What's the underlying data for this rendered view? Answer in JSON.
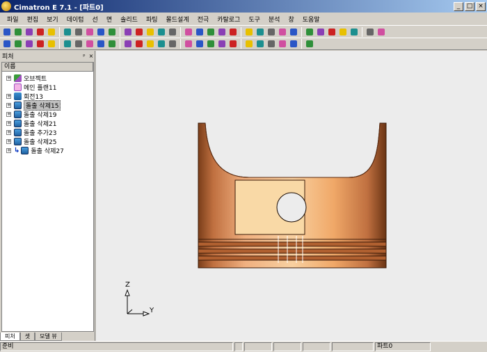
{
  "window": {
    "title": "Cimatron E 7.1 - [파트0]",
    "controls": [
      "_",
      "□",
      "×"
    ]
  },
  "menu": [
    "파일",
    "편집",
    "보기",
    "데이텀",
    "선",
    "면",
    "솔리드",
    "파팅",
    "몰드설계",
    "전극",
    "카탈로그",
    "도구",
    "분석",
    "창",
    "도움말"
  ],
  "toolbar1_icons": [
    "new-icon",
    "open-icon",
    "save-icon",
    "print-icon",
    "undo-icon",
    "redo-icon",
    "link-icon",
    "filter-icon",
    "zoom-fit-icon",
    "zoom-window-icon",
    "zoom-icon",
    "pan-icon",
    "rotate-icon",
    "view-iso-icon",
    "view-front-icon",
    "view-top-icon",
    "view-right-icon",
    "view-left-icon",
    "view-back-icon",
    "view-bottom-icon",
    "render-mode-icon",
    "shade-icon",
    "wireframe-icon",
    "light-icon",
    "bulb-icon",
    "color-icon",
    "arrow-left-icon",
    "arrow-right-icon",
    "grid-icon",
    "paint-icon",
    "pen-icon",
    "measure-icon"
  ],
  "toolbar2_icons": [
    "pick-icon",
    "delete-icon",
    "select-icon",
    "sketch-icon",
    "extrude-icon",
    "revolve-icon",
    "sweep-icon",
    "loft-icon",
    "shell-icon",
    "fillet-icon",
    "chamfer-icon",
    "draft-icon",
    "point-icon",
    "line-icon",
    "spline-icon",
    "circle-icon",
    "trim-icon",
    "offset-icon",
    "curve-icon",
    "surface-icon",
    "blend-icon",
    "patch-icon",
    "split-icon",
    "mirror-icon",
    "pattern-icon",
    "analysis-icon"
  ],
  "panel": {
    "title": "피처",
    "pin": "ᵖ",
    "close": "×",
    "column_header": "이름",
    "tabs": [
      "피처",
      "셋",
      "모델 뷰"
    ]
  },
  "tree": [
    {
      "label": "오브젝트",
      "icon": "obj",
      "expander": "+",
      "selected": false,
      "arrow": false
    },
    {
      "label": "메인 플랜11",
      "icon": "plane",
      "expander": "",
      "selected": false,
      "arrow": false
    },
    {
      "label": "회전13",
      "icon": "rev",
      "expander": "+",
      "selected": false,
      "arrow": false
    },
    {
      "label": "돌출 삭제15",
      "icon": "cut",
      "expander": "+",
      "selected": true,
      "arrow": false
    },
    {
      "label": "돌출 삭제19",
      "icon": "cut",
      "expander": "+",
      "selected": false,
      "arrow": false
    },
    {
      "label": "돌출 삭제21",
      "icon": "cut",
      "expander": "+",
      "selected": false,
      "arrow": false
    },
    {
      "label": "돌출 추가23",
      "icon": "cut",
      "expander": "+",
      "selected": false,
      "arrow": false
    },
    {
      "label": "돌출 삭제25",
      "icon": "cut",
      "expander": "+",
      "selected": false,
      "arrow": false
    },
    {
      "label": "돌출 삭제27",
      "icon": "cut",
      "expander": "+",
      "selected": false,
      "arrow": true
    }
  ],
  "axis": {
    "z": "Z",
    "y": "Y"
  },
  "status": {
    "left": "준비",
    "right": "파트0"
  },
  "colors": {
    "part_light": "#f8d8a0",
    "part_mid": "#e0945a",
    "part_dark": "#7a3e1a",
    "viewport_bg": "#ececec"
  }
}
